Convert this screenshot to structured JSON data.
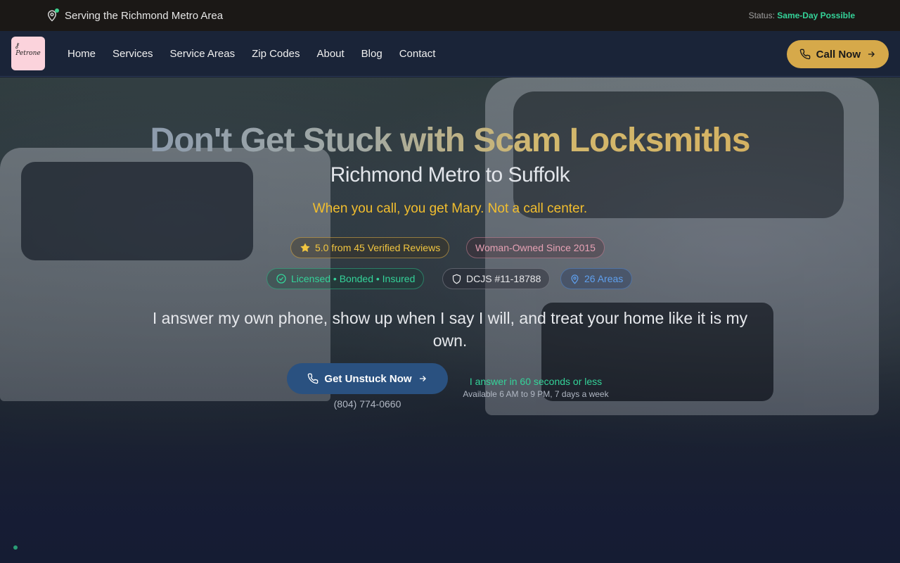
{
  "topbar": {
    "location_text": "Serving the Richmond Metro Area",
    "status_label": "Status:",
    "status_value": "Same-Day Possible"
  },
  "nav": {
    "logo_text": "Petrone",
    "links": [
      "Home",
      "Services",
      "Service Areas",
      "Zip Codes",
      "About",
      "Blog",
      "Contact"
    ],
    "call_button": "Call Now"
  },
  "hero": {
    "headline": "Don't Get Stuck with Scam Locksmiths",
    "subheadline": "Richmond Metro to Suffolk",
    "tagline": "When you call, you get Mary. Not a call center.",
    "badges": {
      "reviews": "5.0 from 45 Verified Reviews",
      "woman_owned": "Woman-Owned Since 2015",
      "licensed": "Licensed • Bonded • Insured",
      "dcjs": "DCJS #11-18788",
      "areas": "26 Areas"
    },
    "mission": "I answer my own phone, show up when I say I will, and treat your home like it is my own.",
    "cta_button": "Get Unstuck Now",
    "phone": "(804) 774-0660",
    "answer_text": "I answer in 60 seconds or less",
    "hours_text": "Available 6 AM to 9 PM, 7 days a week"
  },
  "colors": {
    "accent_gold": "#d6a94a",
    "status_green": "#34d399",
    "tagline_yellow": "#f2be2e",
    "cta_blue": "#2a5180"
  },
  "icons": [
    "map-pin-icon",
    "phone-icon",
    "arrow-right-icon",
    "star-icon",
    "check-circle-icon",
    "shield-icon"
  ]
}
